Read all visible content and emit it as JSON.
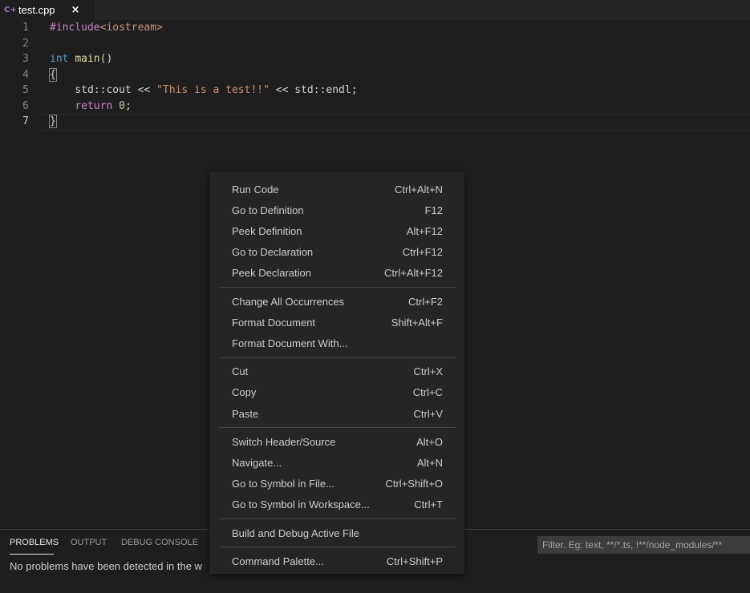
{
  "tab": {
    "icon": "C+",
    "label": "test.cpp",
    "close": "×"
  },
  "editor": {
    "lines": [
      {
        "n": "1",
        "parts": [
          {
            "t": "#include",
            "c": "dir"
          },
          {
            "t": "<iostream>",
            "c": "str"
          }
        ]
      },
      {
        "n": "2",
        "parts": []
      },
      {
        "n": "3",
        "parts": [
          {
            "t": "int",
            "c": "type"
          },
          {
            "t": " ",
            "c": ""
          },
          {
            "t": "main",
            "c": "fn"
          },
          {
            "t": "()",
            "c": ""
          }
        ]
      },
      {
        "n": "4",
        "parts": [
          {
            "t": "{",
            "c": "brace"
          }
        ]
      },
      {
        "n": "5",
        "parts": [
          {
            "t": "    std::cout << ",
            "c": ""
          },
          {
            "t": "\"This is a test!!\"",
            "c": "str"
          },
          {
            "t": " << std::endl;",
            "c": ""
          }
        ]
      },
      {
        "n": "6",
        "parts": [
          {
            "t": "    ",
            "c": ""
          },
          {
            "t": "return",
            "c": "ctl"
          },
          {
            "t": " ",
            "c": ""
          },
          {
            "t": "0",
            "c": "num"
          },
          {
            "t": ";",
            "c": ""
          }
        ]
      },
      {
        "n": "7",
        "parts": [
          {
            "t": "}",
            "c": "brace"
          }
        ]
      }
    ]
  },
  "panel": {
    "tabs": [
      "PROBLEMS",
      "OUTPUT",
      "DEBUG CONSOLE"
    ],
    "filter_placeholder": "Filter. Eg: text, **/*.ts, !**/node_modules/**",
    "message": "No problems have been detected in the w"
  },
  "menu": {
    "groups": [
      [
        {
          "label": "Run Code",
          "key": "Ctrl+Alt+N"
        },
        {
          "label": "Go to Definition",
          "key": "F12"
        },
        {
          "label": "Peek Definition",
          "key": "Alt+F12"
        },
        {
          "label": "Go to Declaration",
          "key": "Ctrl+F12"
        },
        {
          "label": "Peek Declaration",
          "key": "Ctrl+Alt+F12"
        }
      ],
      [
        {
          "label": "Change All Occurrences",
          "key": "Ctrl+F2"
        },
        {
          "label": "Format Document",
          "key": "Shift+Alt+F"
        },
        {
          "label": "Format Document With...",
          "key": ""
        }
      ],
      [
        {
          "label": "Cut",
          "key": "Ctrl+X"
        },
        {
          "label": "Copy",
          "key": "Ctrl+C"
        },
        {
          "label": "Paste",
          "key": "Ctrl+V"
        }
      ],
      [
        {
          "label": "Switch Header/Source",
          "key": "Alt+O"
        },
        {
          "label": "Navigate...",
          "key": "Alt+N"
        },
        {
          "label": "Go to Symbol in File...",
          "key": "Ctrl+Shift+O"
        },
        {
          "label": "Go to Symbol in Workspace...",
          "key": "Ctrl+T"
        }
      ],
      [
        {
          "label": "Build and Debug Active File",
          "key": ""
        }
      ],
      [
        {
          "label": "Command Palette...",
          "key": "Ctrl+Shift+P"
        }
      ]
    ]
  }
}
